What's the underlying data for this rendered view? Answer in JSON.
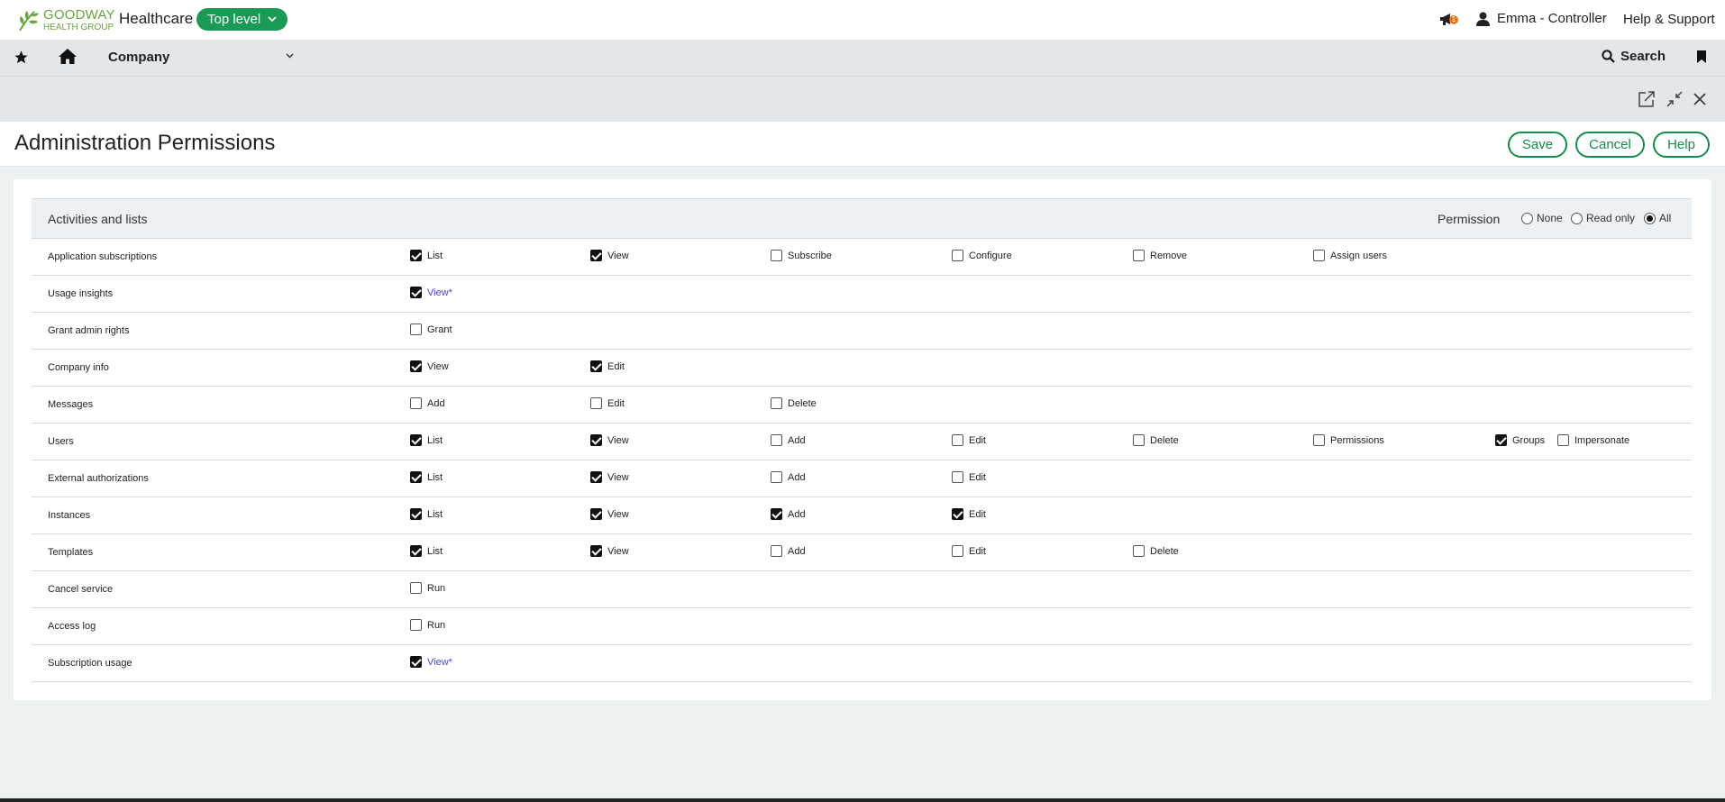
{
  "header": {
    "logo_line1": "GOODWAY",
    "logo_line2": "HEALTH GROUP",
    "org_name": "Healthcare",
    "level_label": "Top level",
    "notification_count": "1",
    "user_label": "Emma - Controller",
    "help_label": "Help & Support"
  },
  "nav": {
    "company_label": "Company",
    "search_label": "Search"
  },
  "page": {
    "title": "Administration Permissions",
    "save_label": "Save",
    "cancel_label": "Cancel",
    "help_label": "Help"
  },
  "table": {
    "section_title": "Activities and lists",
    "permission_label": "Permission",
    "permission_options": [
      "None",
      "Read only",
      "All"
    ],
    "permission_selected": "All",
    "rows": [
      {
        "label": "Application subscriptions",
        "cells": [
          {
            "label": "List",
            "checked": true
          },
          {
            "label": "View",
            "checked": true
          },
          {
            "label": "Subscribe",
            "checked": false
          },
          {
            "label": "Configure",
            "checked": false
          },
          {
            "label": "Remove",
            "checked": false
          },
          {
            "label": "Assign users",
            "checked": false
          }
        ]
      },
      {
        "label": "Usage insights",
        "cells": [
          {
            "label": "View*",
            "checked": true,
            "link": true
          }
        ]
      },
      {
        "label": "Grant admin rights",
        "cells": [
          {
            "label": "Grant",
            "checked": false
          }
        ]
      },
      {
        "label": "Company info",
        "cells": [
          {
            "label": "View",
            "checked": true
          },
          {
            "label": "Edit",
            "checked": true
          }
        ]
      },
      {
        "label": "Messages",
        "cells": [
          {
            "label": "Add",
            "checked": false
          },
          {
            "label": "Edit",
            "checked": false
          },
          {
            "label": "Delete",
            "checked": false
          }
        ]
      },
      {
        "label": "Users",
        "cells": [
          {
            "label": "List",
            "checked": true
          },
          {
            "label": "View",
            "checked": true
          },
          {
            "label": "Add",
            "checked": false
          },
          {
            "label": "Edit",
            "checked": false
          },
          {
            "label": "Delete",
            "checked": false
          },
          {
            "label": "Permissions",
            "checked": false
          },
          {
            "label": "Groups",
            "checked": true
          },
          {
            "label": "Impersonate",
            "checked": false
          }
        ]
      },
      {
        "label": "External authorizations",
        "cells": [
          {
            "label": "List",
            "checked": true
          },
          {
            "label": "View",
            "checked": true
          },
          {
            "label": "Add",
            "checked": false
          },
          {
            "label": "Edit",
            "checked": false
          }
        ]
      },
      {
        "label": "Instances",
        "cells": [
          {
            "label": "List",
            "checked": true
          },
          {
            "label": "View",
            "checked": true
          },
          {
            "label": "Add",
            "checked": true
          },
          {
            "label": "Edit",
            "checked": true
          }
        ]
      },
      {
        "label": "Templates",
        "cells": [
          {
            "label": "List",
            "checked": true
          },
          {
            "label": "View",
            "checked": true
          },
          {
            "label": "Add",
            "checked": false
          },
          {
            "label": "Edit",
            "checked": false
          },
          {
            "label": "Delete",
            "checked": false
          }
        ]
      },
      {
        "label": "Cancel service",
        "cells": [
          {
            "label": "Run",
            "checked": false
          }
        ]
      },
      {
        "label": "Access log",
        "cells": [
          {
            "label": "Run",
            "checked": false
          }
        ]
      },
      {
        "label": "Subscription usage",
        "cells": [
          {
            "label": "View*",
            "checked": true,
            "link": true
          }
        ]
      }
    ]
  },
  "colors": {
    "brand_green": "#1a9a55",
    "button_green": "#1a8a4a",
    "logo_green": "#6aa341",
    "link_blue": "#4a4ab8",
    "notification_orange": "#e87722"
  },
  "icons": [
    "star-icon",
    "home-icon",
    "chevron-down-icon",
    "search-icon",
    "bookmark-icon",
    "megaphone-icon",
    "user-icon",
    "open-external-icon",
    "collapse-icon",
    "close-icon",
    "leaf-logo-icon"
  ]
}
